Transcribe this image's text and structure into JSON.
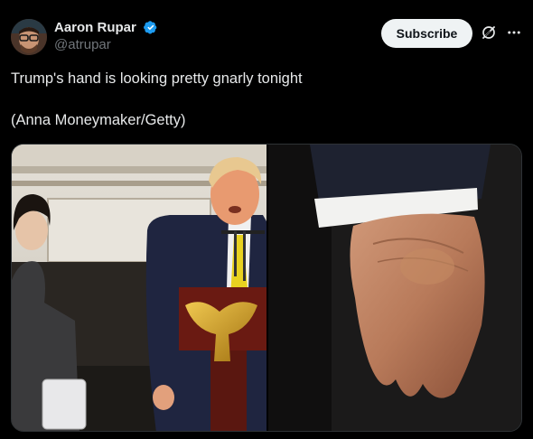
{
  "author": {
    "display_name": "Aaron Rupar",
    "handle": "@atrupar",
    "avatar_icon": "avatar-photo",
    "verified_icon": "verified-badge-icon"
  },
  "actions": {
    "subscribe_label": "Subscribe",
    "grok_icon": "grok-icon",
    "more_icon": "more-options-icon"
  },
  "tweet": {
    "line1": "Trump's hand is looking pretty gnarly tonight",
    "line2": "(Anna Moneymaker/Getty)"
  },
  "media": {
    "images": [
      {
        "name": "photo-podium"
      },
      {
        "name": "photo-hand-closeup"
      }
    ]
  },
  "colors": {
    "background": "#000000",
    "text": "#e7e9ea",
    "secondary_text": "#71767b",
    "verified_blue": "#1d9bf0",
    "button_bg": "#eff3f4"
  }
}
